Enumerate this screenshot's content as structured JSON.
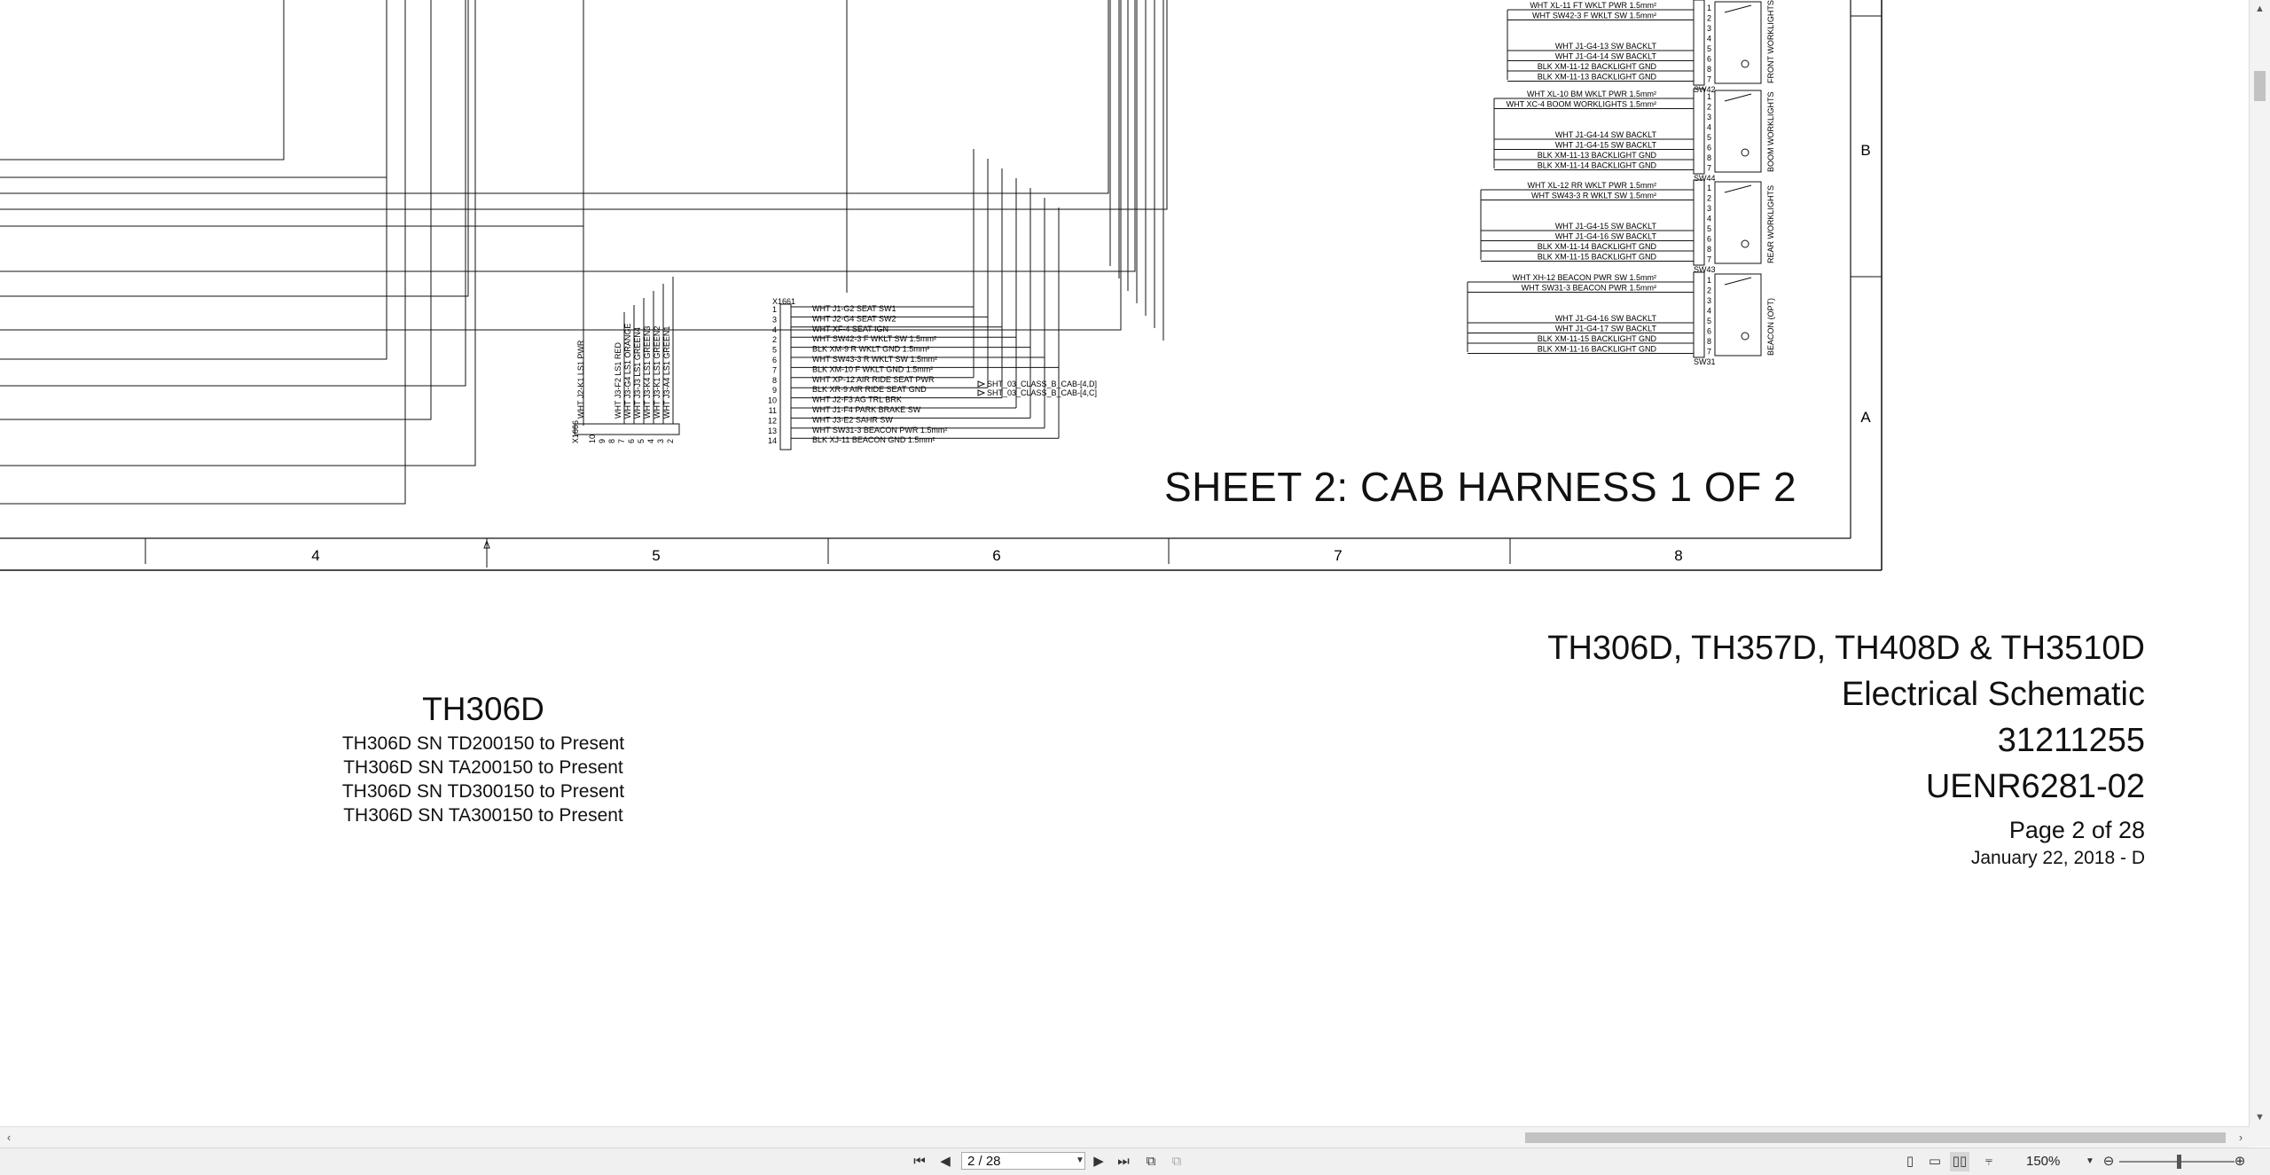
{
  "schematic": {
    "sheet_label": "SHEET 2: CAB HARNESS 1 OF 2",
    "row_labels": [
      "B",
      "A"
    ],
    "column_labels": [
      "4",
      "5",
      "6",
      "7",
      "8"
    ],
    "connector_x1661": {
      "name": "X1661",
      "pins": [
        {
          "pin": "1",
          "wire": "WHT J1-G2 SEAT SW1"
        },
        {
          "pin": "3",
          "wire": "WHT J2-G4 SEAT SW2"
        },
        {
          "pin": "4",
          "wire": "WHT XF-4 SEAT IGN"
        },
        {
          "pin": "2",
          "wire": "WHT SW42-3 F WKLT SW 1.5mm²"
        },
        {
          "pin": "5",
          "wire": "BLK XM-9 R WKLT GND 1.5mm²"
        },
        {
          "pin": "6",
          "wire": "WHT SW43-3 R WKLT SW 1.5mm²"
        },
        {
          "pin": "7",
          "wire": "BLK XM-10 F WKLT GND 1.5mm²"
        },
        {
          "pin": "8",
          "wire": "WHT XP-12 AIR RIDE SEAT PWR"
        },
        {
          "pin": "9",
          "wire": "BLK XR-9 AIR RIDE SEAT GND"
        },
        {
          "pin": "10",
          "wire": "WHT J2-F3 AG TRL BRK"
        },
        {
          "pin": "11",
          "wire": "WHT J1-F4 PARK BRAKE SW"
        },
        {
          "pin": "12",
          "wire": "WHT J3-E2 SAHR SW"
        },
        {
          "pin": "13",
          "wire": "WHT SW31-3 BEACON PWR 1.5mm²"
        },
        {
          "pin": "14",
          "wire": "BLK XJ-11 BEACON GND 1.5mm²"
        }
      ],
      "offsheet_refs": [
        "SHT_03_CLASS_B_CAB-[4,D]",
        "SHT_03_CLASS_B_CAB-[4,C]"
      ]
    },
    "connector_x1666": {
      "name": "X1666",
      "pins": [
        "10",
        "9",
        "8",
        "7",
        "6",
        "5",
        "4",
        "3",
        "2"
      ],
      "wires": [
        "WHT J2-K1 LS1 PWR",
        "WHT J3-F2 LS1 RED",
        "WHT J3-G4 LS1 ORANGE",
        "WHT J3-J3 LS1 GREEN4",
        "WHT J3-K4 LS1 GREEN3",
        "WHT J3-K1 LS1 GREEN2",
        "WHT J3-A4 LS1 GREEN1"
      ]
    },
    "switches": [
      {
        "name": "FRONT WORKLIGHTS",
        "ref": "SW42",
        "wires": [
          {
            "pin": "1",
            "wire": "WHT XL-11 FT WKLT PWR 1.5mm²"
          },
          {
            "pin": "2",
            "wire": "WHT SW42-3 F WKLT SW 1.5mm²"
          },
          {
            "pin": "3",
            "wire": ""
          },
          {
            "pin": "4",
            "wire": ""
          },
          {
            "pin": "5",
            "wire": "WHT J1-G4-13 SW BACKLT"
          },
          {
            "pin": "6",
            "wire": "WHT J1-G4-14 SW BACKLT"
          },
          {
            "pin": "8",
            "wire": "BLK XM-11-12 BACKLIGHT GND"
          },
          {
            "pin": "7",
            "wire": "BLK XM-11-13 BACKLIGHT GND"
          }
        ]
      },
      {
        "name": "BOOM WORKLIGHTS",
        "ref": "SW44",
        "wires": [
          {
            "pin": "1",
            "wire": "WHT XL-10 BM WKLT PWR 1.5mm²"
          },
          {
            "pin": "2",
            "wire": "WHT XC-4 BOOM WORKLIGHTS 1.5mm²"
          },
          {
            "pin": "3",
            "wire": ""
          },
          {
            "pin": "4",
            "wire": ""
          },
          {
            "pin": "5",
            "wire": "WHT J1-G4-14 SW BACKLT"
          },
          {
            "pin": "6",
            "wire": "WHT J1-G4-15 SW BACKLT"
          },
          {
            "pin": "8",
            "wire": "BLK XM-11-13 BACKLIGHT GND"
          },
          {
            "pin": "7",
            "wire": "BLK XM-11-14 BACKLIGHT GND"
          }
        ]
      },
      {
        "name": "REAR WORKLIGHTS",
        "ref": "SW43",
        "wires": [
          {
            "pin": "1",
            "wire": "WHT XL-12 RR WKLT PWR 1.5mm²"
          },
          {
            "pin": "2",
            "wire": "WHT SW43-3 R WKLT SW 1.5mm²"
          },
          {
            "pin": "3",
            "wire": ""
          },
          {
            "pin": "4",
            "wire": ""
          },
          {
            "pin": "5",
            "wire": "WHT J1-G4-15 SW BACKLT"
          },
          {
            "pin": "6",
            "wire": "WHT J1-G4-16 SW BACKLT"
          },
          {
            "pin": "8",
            "wire": "BLK XM-11-14 BACKLIGHT GND"
          },
          {
            "pin": "7",
            "wire": "BLK XM-11-15 BACKLIGHT GND"
          }
        ]
      },
      {
        "name": "BEACON (OPT)",
        "ref": "SW31",
        "wires": [
          {
            "pin": "1",
            "wire": "WHT XH-12 BEACON PWR SW 1.5mm²"
          },
          {
            "pin": "2",
            "wire": "WHT SW31-3 BEACON PWR 1.5mm²"
          },
          {
            "pin": "3",
            "wire": ""
          },
          {
            "pin": "4",
            "wire": ""
          },
          {
            "pin": "5",
            "wire": "WHT J1-G4-16 SW BACKLT"
          },
          {
            "pin": "6",
            "wire": "WHT J1-G4-17 SW BACKLT"
          },
          {
            "pin": "8",
            "wire": "BLK XM-11-15 BACKLIGHT GND"
          },
          {
            "pin": "7",
            "wire": "BLK XM-11-16 BACKLIGHT GND"
          }
        ]
      }
    ]
  },
  "title_block": {
    "models": "TH306D, TH357D, TH408D & TH3510D",
    "doc_type": "Electrical Schematic",
    "part_number": "31211255",
    "doc_number": "UENR6281-02",
    "page": "Page 2 of 28",
    "date": "January 22, 2018 - D"
  },
  "model_block": {
    "model": "TH306D",
    "serials": [
      "TH306D SN TD200150 to Present",
      "TH306D SN TA200150 to Present",
      "TH306D SN TD300150 to Present",
      "TH306D SN TA300150 to Present"
    ]
  },
  "status_bar": {
    "page_field": "2 / 28",
    "zoom": "150%"
  },
  "icons": {
    "first_page": "first-page-icon",
    "prev_page": "prev-page-icon",
    "next_page": "next-page-icon",
    "last_page": "last-page-icon",
    "zoom_out": "zoom-out-icon",
    "zoom_in": "zoom-in-icon"
  }
}
